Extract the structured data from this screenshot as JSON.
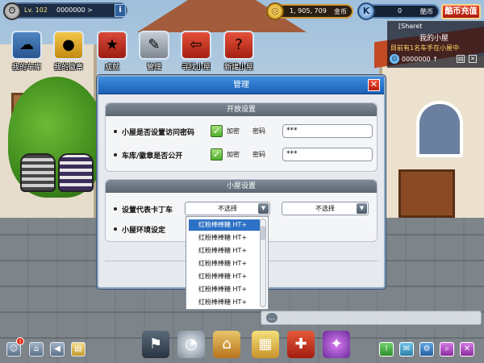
{
  "top": {
    "level": "Lv. 102",
    "exp": "0000000 >",
    "coins": "1, 905, 709",
    "coins_unit": "金币",
    "k_points": "0",
    "k_unit": "酷币",
    "recharge": "酷币充值"
  },
  "menu": [
    {
      "label": "我的车库",
      "icon": "car-garage-icon"
    },
    {
      "label": "我的徽章",
      "icon": "medal-icon"
    },
    {
      "label": "成就",
      "icon": "star-icon"
    },
    {
      "label": "管理",
      "icon": "tools-icon"
    },
    {
      "label": "寻找小屋",
      "icon": "house-arrow-icon"
    },
    {
      "label": "新建小屋",
      "icon": "house-question-icon"
    }
  ],
  "room_info": {
    "owner": "[Sharet",
    "name": "我的小屋",
    "status": "目前有1名车手在小屋中",
    "points": "0000000 ↑"
  },
  "dialog": {
    "title": "管理",
    "open_settings": {
      "header": "开放设置",
      "rows": [
        {
          "label": "小屋是否设置访问密码",
          "check_label": "加密",
          "pw_label": "密码",
          "pw_value": "***"
        },
        {
          "label": "车库/徽章是否公开",
          "check_label": "加密",
          "pw_label": "密码",
          "pw_value": "***"
        }
      ]
    },
    "room_settings": {
      "header": "小屋设置",
      "rep_kart_label": "设置代表卡丁车",
      "env_label": "小屋环境设定",
      "select1": "不选择",
      "select2": "不选择"
    },
    "dropdown_options": [
      "红粉棒棒糖 HT+",
      "红粉棒棒糖 HT+",
      "红粉棒棒糖 HT+",
      "红粉棒棒糖 HT+",
      "红粉棒棒糖 HT+",
      "红粉棒棒糖 HT+",
      "红粉棒棒糖 HT+"
    ]
  },
  "bottom": {
    "badge": "!",
    "left_icons": [
      "character-icon",
      "home-icon",
      "back-icon",
      "notes-icon"
    ],
    "center_icons": [
      "race-flag-icon",
      "speedometer-icon",
      "garage-icon",
      "shop-icon",
      "toolbox-icon",
      "gem-icon"
    ],
    "right_icons": [
      "alert-icon",
      "chat-icon",
      "settings-icon",
      "search-icon",
      "close-icon"
    ]
  },
  "colors": {
    "title_blue": "#1b5fb6",
    "check_green": "#4fae2a",
    "close_red": "#e5301c",
    "highlight": "#2d71c6"
  }
}
